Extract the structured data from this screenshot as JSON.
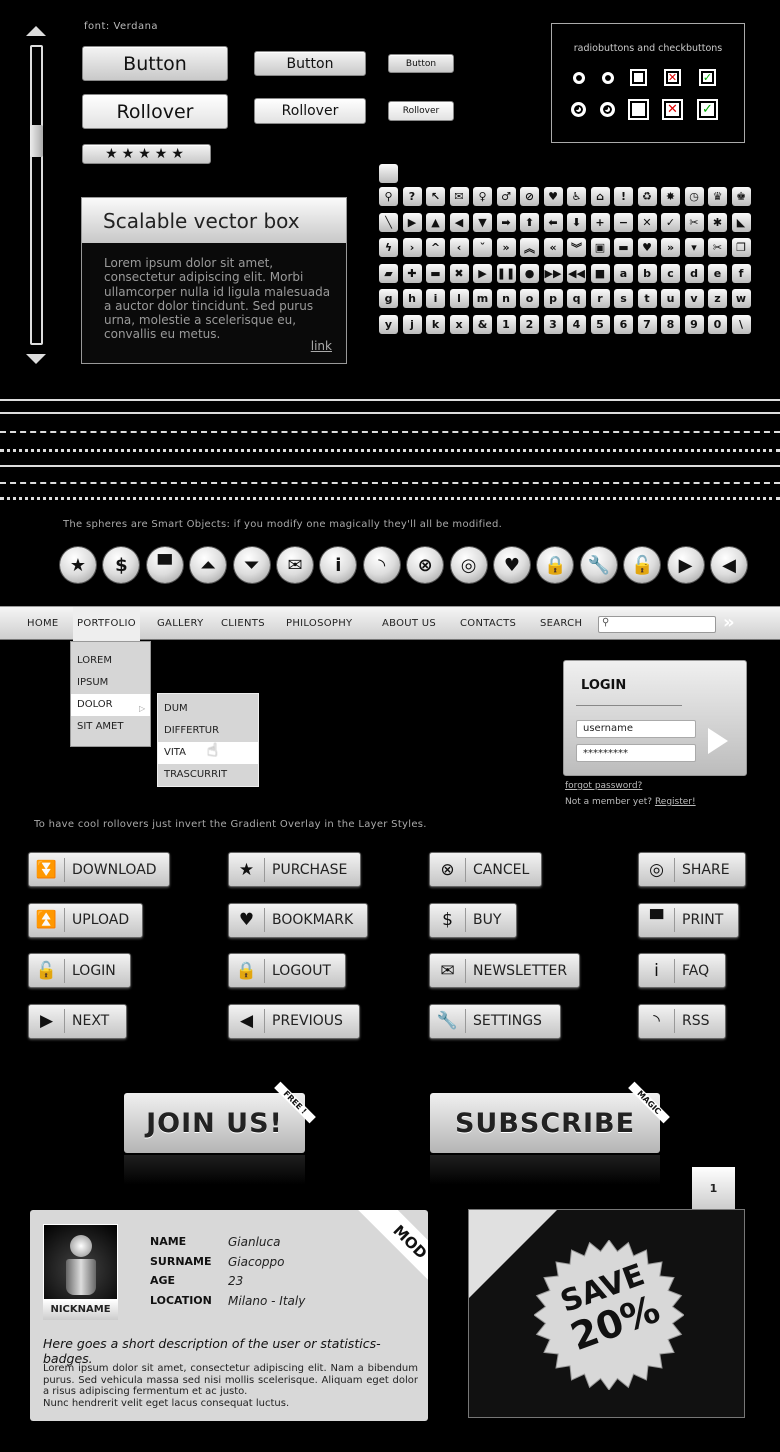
{
  "font_note": "font: Verdana",
  "buttons": {
    "large": [
      "Button",
      "Rollover"
    ],
    "medium": [
      "Button",
      "Rollover"
    ],
    "small": [
      "Button",
      "Rollover"
    ],
    "rating_stars": 5
  },
  "radio_panel": {
    "title": "radiobuttons and checkbuttons"
  },
  "vector_box": {
    "title": "Scalable vector box",
    "body": "Lorem ipsum dolor sit amet, consectetur adipiscing elit. Morbi ullamcorper nulla id ligula malesuada a auctor dolor tincidunt. Sed purus urna, molestie a scelerisque eu, convallis eu metus.",
    "link": "link"
  },
  "icon_grid": [
    [
      "⚲",
      "?",
      "↖",
      "✉",
      "♀",
      "♂",
      "⊘",
      "♥",
      "♿",
      "⌂",
      "!",
      "♻",
      "✸",
      "◷",
      "♛",
      "♚"
    ],
    [
      "╲",
      "▶",
      "▲",
      "◀",
      "▼",
      "➡",
      "⬆",
      "⬅",
      "⬇",
      "+",
      "−",
      "✕",
      "✓",
      "✂",
      "✱",
      "◣"
    ],
    [
      "ϟ",
      "›",
      "^",
      "‹",
      "ˇ",
      "»",
      "︽",
      "«",
      "︾",
      "▣",
      "▬",
      "♥",
      "»",
      "▾",
      "✂",
      "❐"
    ],
    [
      "▰",
      "✚",
      "▬",
      "✖",
      "▶",
      "❚❚",
      "●",
      "▶▶",
      "◀◀",
      "■",
      "a",
      "b",
      "c",
      "d",
      "e",
      "f"
    ],
    [
      "g",
      "h",
      "i",
      "l",
      "m",
      "n",
      "o",
      "p",
      "q",
      "r",
      "s",
      "t",
      "u",
      "v",
      "z",
      "w"
    ],
    [
      "y",
      "j",
      "k",
      "x",
      "&",
      "1",
      "2",
      "3",
      "4",
      "5",
      "6",
      "7",
      "8",
      "9",
      "0",
      "\\"
    ]
  ],
  "spheres_note": "The spheres are Smart Objects: if you modify one magically they'll all be modified.",
  "spheres": [
    {
      "icon": "star-icon",
      "glyph": "★"
    },
    {
      "icon": "dollar-icon",
      "glyph": "$"
    },
    {
      "icon": "printer-icon",
      "glyph": "▀"
    },
    {
      "icon": "upload-icon",
      "glyph": "⏶"
    },
    {
      "icon": "download-icon",
      "glyph": "⏷"
    },
    {
      "icon": "mail-icon",
      "glyph": "✉"
    },
    {
      "icon": "info-icon",
      "glyph": "i"
    },
    {
      "icon": "rss-icon",
      "glyph": "◝"
    },
    {
      "icon": "cancel-icon",
      "glyph": "⊗"
    },
    {
      "icon": "target-icon",
      "glyph": "◎"
    },
    {
      "icon": "heart-icon",
      "glyph": "♥"
    },
    {
      "icon": "lock-icon",
      "glyph": "🔒"
    },
    {
      "icon": "wrench-icon",
      "glyph": "🔧"
    },
    {
      "icon": "unlock-icon",
      "glyph": "🔓"
    },
    {
      "icon": "play-icon",
      "glyph": "▶"
    },
    {
      "icon": "back-icon",
      "glyph": "◀"
    }
  ],
  "nav": {
    "items": [
      "HOME",
      "PORTFOLIO",
      "GALLERY",
      "CLIENTS",
      "PHILOSOPHY",
      "ABOUT US",
      "CONTACTS",
      "SEARCH"
    ],
    "active": "PORTFOLIO",
    "search_placeholder": "",
    "go": "»"
  },
  "dropdown": {
    "items": [
      "LOREM",
      "IPSUM",
      "DOLOR",
      "SIT AMET"
    ],
    "active": "DOLOR"
  },
  "submenu": {
    "items": [
      "DUM",
      "DIFFERTUR",
      "VITA",
      "TRASCURRIT"
    ],
    "active": "VITA"
  },
  "login": {
    "title": "LOGIN",
    "username": "username",
    "password": "*********",
    "forgot": "forgot password?",
    "not_member": "Not a member yet?",
    "register": "Register!"
  },
  "rollover_note": "To have cool rollovers just invert the Gradient Overlay in the Layer Styles.",
  "action_buttons": [
    [
      {
        "label": "DOWNLOAD",
        "icon": "download-icon",
        "glyph": "⏬"
      },
      {
        "label": "UPLOAD",
        "icon": "upload-icon",
        "glyph": "⏫"
      },
      {
        "label": "LOGIN",
        "icon": "unlock-icon",
        "glyph": "🔓"
      },
      {
        "label": "NEXT",
        "icon": "play-icon",
        "glyph": "▶"
      }
    ],
    [
      {
        "label": "PURCHASE",
        "icon": "star-icon",
        "glyph": "★"
      },
      {
        "label": "BOOKMARK",
        "icon": "heart-icon",
        "glyph": "♥"
      },
      {
        "label": "LOGOUT",
        "icon": "lock-icon",
        "glyph": "🔒"
      },
      {
        "label": "PREVIOUS",
        "icon": "back-icon",
        "glyph": "◀"
      }
    ],
    [
      {
        "label": "CANCEL",
        "icon": "cancel-icon",
        "glyph": "⊗"
      },
      {
        "label": "BUY",
        "icon": "dollar-icon",
        "glyph": "$"
      },
      {
        "label": "NEWSLETTER",
        "icon": "mail-icon",
        "glyph": "✉"
      },
      {
        "label": "SETTINGS",
        "icon": "wrench-icon",
        "glyph": "🔧"
      }
    ],
    [
      {
        "label": "SHARE",
        "icon": "target-icon",
        "glyph": "◎"
      },
      {
        "label": "PRINT",
        "icon": "printer-icon",
        "glyph": "▀"
      },
      {
        "label": "FAQ",
        "icon": "info-icon",
        "glyph": "i"
      },
      {
        "label": "RSS",
        "icon": "rss-icon",
        "glyph": "◝"
      }
    ]
  ],
  "cta": {
    "join": "JOIN US!",
    "join_ribbon": "FREE !",
    "subscribe": "SUBSCRIBE",
    "subscribe_ribbon": "MAGIC"
  },
  "profile": {
    "ribbon": "MOD",
    "nickname": "NICKNAME",
    "fields": [
      {
        "label": "NAME",
        "value": "Gianluca"
      },
      {
        "label": "SURNAME",
        "value": "Giacoppo"
      },
      {
        "label": "AGE",
        "value": "23"
      },
      {
        "label": "LOCATION",
        "value": "Milano - Italy"
      }
    ],
    "description": "Here goes a short description of the user or statistics-badges.",
    "body1": "Lorem ipsum dolor sit amet, consectetur adipiscing elit. Nam a bibendum purus. Sed vehicula massa sed nisi mollis scelerisque. Aliquam eget dolor a risus adipiscing fermentum et ac justo.",
    "body2": "Nunc hendrerit velit eget lacus consequat luctus."
  },
  "save_box": {
    "tab": "1",
    "line1": "SAVE",
    "line2": "20%"
  }
}
